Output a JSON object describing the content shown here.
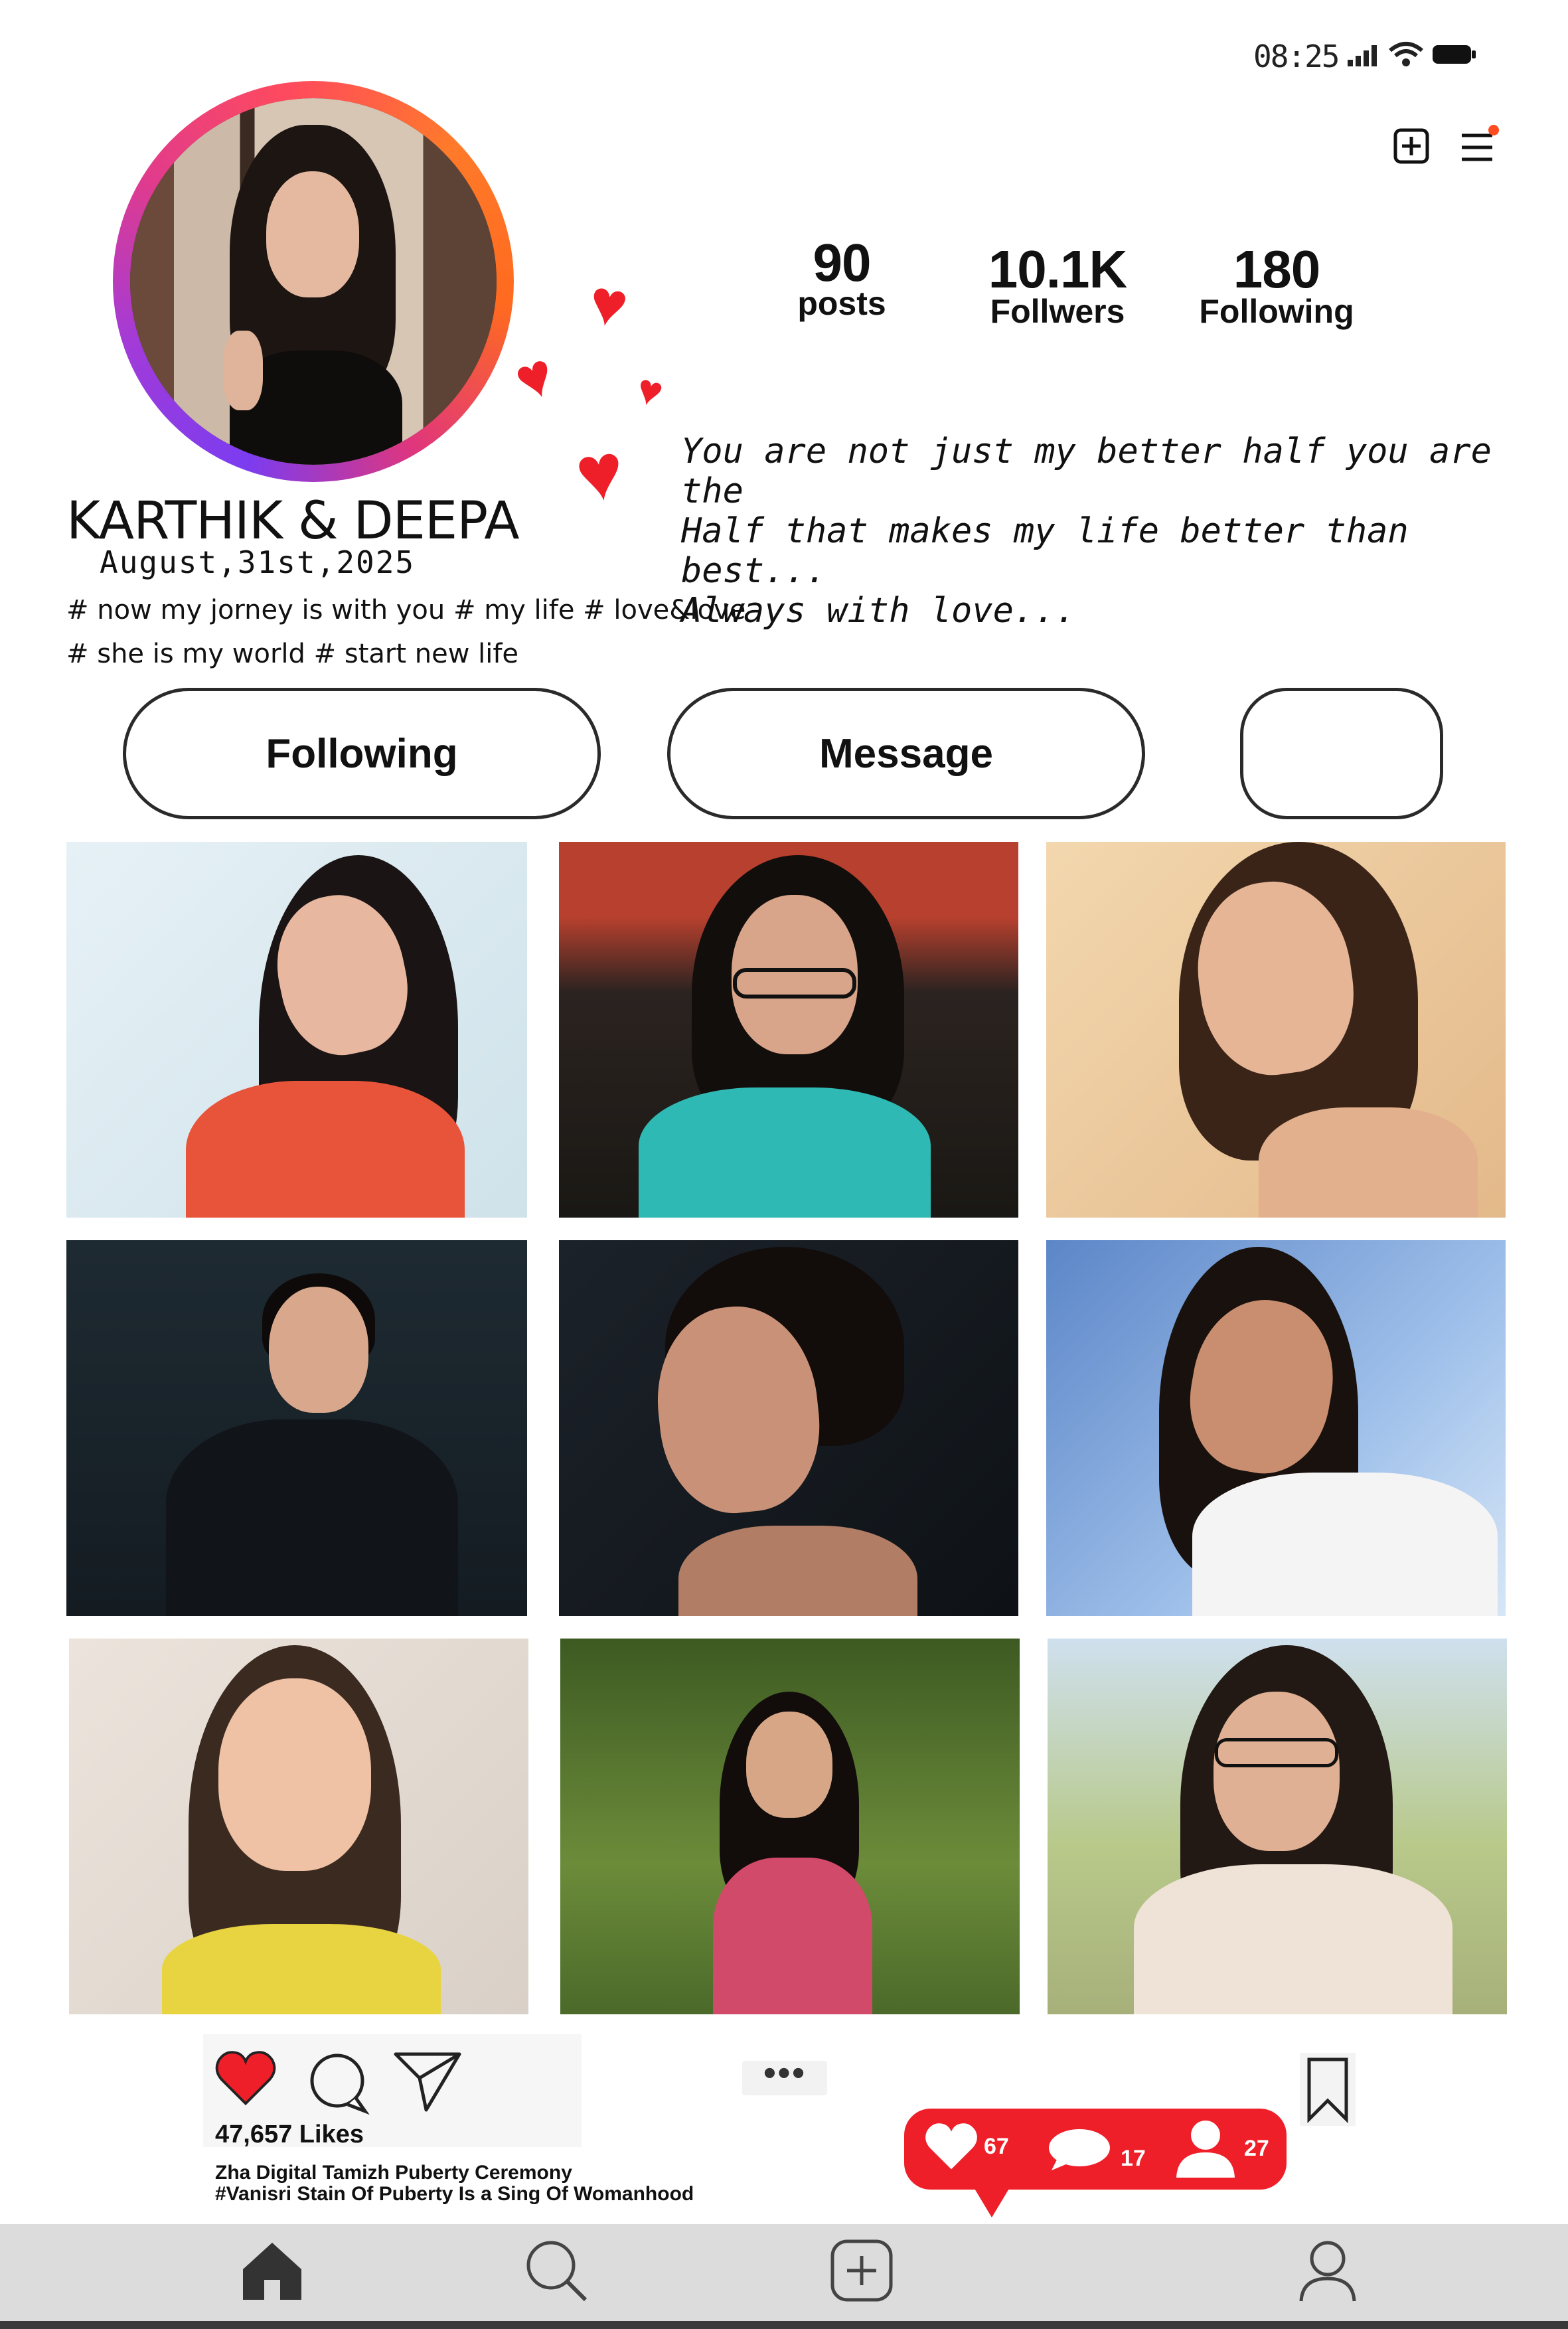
{
  "status_bar": {
    "time": "08:25",
    "signal_icon": "signal-icon",
    "wifi_icon": "wifi-icon",
    "battery_icon": "battery-icon"
  },
  "header": {
    "add_icon": "plus-square-icon",
    "menu_icon": "hamburger-menu-icon",
    "notification_dot_color": "#ff4b1f"
  },
  "profile": {
    "name": "KARTHIK & DEEPA",
    "date": "August,31st,2025",
    "hashtags_line1": "# now my jorney is with you  # my life # love&love",
    "hashtags_line2": "# she is my world # start new life",
    "bio": "You are not just my better half you are the\n Half that makes my life better than best...\n Always with love..."
  },
  "stats": {
    "posts": {
      "value": "90",
      "label": "posts"
    },
    "followers": {
      "value": "10.1K",
      "label": "Follwers"
    },
    "following": {
      "value": "180",
      "label": "Following"
    }
  },
  "buttons": {
    "following": "Following",
    "message": "Message",
    "extra": ""
  },
  "post": {
    "likes": "47,657 Likes",
    "caption_line1": "Zha Digital Tamizh Puberty Ceremony",
    "caption_line2": "#Vanisri Stain Of Puberty Is a Sing Of Womanhood",
    "more": "•••"
  },
  "notifications": {
    "likes": "67",
    "comments": "17",
    "followers": "27"
  },
  "nav": {
    "items": [
      "home-icon",
      "search-icon",
      "create-post-icon",
      "profile-icon"
    ]
  },
  "colors": {
    "accent_red": "#ef1f2a",
    "ring_start": "#7b3cf0",
    "ring_end": "#ff7a2a",
    "nav_bg": "#dcdcdc"
  }
}
